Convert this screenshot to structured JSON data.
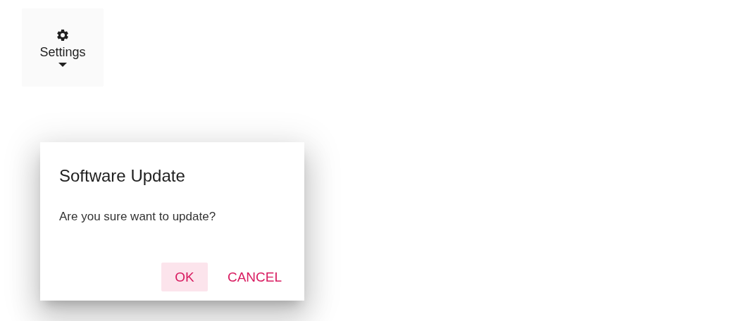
{
  "settings_button": {
    "label": "Settings"
  },
  "dialog": {
    "title": "Software Update",
    "message": "Are you sure want to update?",
    "buttons": [
      {
        "label": "OK",
        "focused": true
      },
      {
        "label": "CANCEL",
        "focused": false
      }
    ]
  }
}
